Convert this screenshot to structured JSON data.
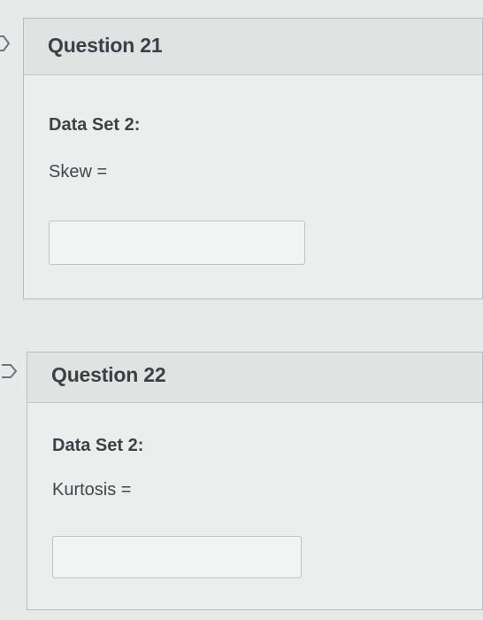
{
  "questions": [
    {
      "title": "Question 21",
      "data_set": "Data Set 2:",
      "prompt": "Skew =",
      "answer_value": "",
      "answer_placeholder": ""
    },
    {
      "title": "Question 22",
      "data_set": "Data Set 2:",
      "prompt": "Kurtosis =",
      "answer_value": "",
      "answer_placeholder": ""
    }
  ],
  "icons": {
    "question_flag": "flag-icon"
  },
  "colors": {
    "background": "#e8eaea",
    "header_background": "#e1e3e3",
    "border": "#b9bdbf",
    "text": "#3c3f44"
  }
}
